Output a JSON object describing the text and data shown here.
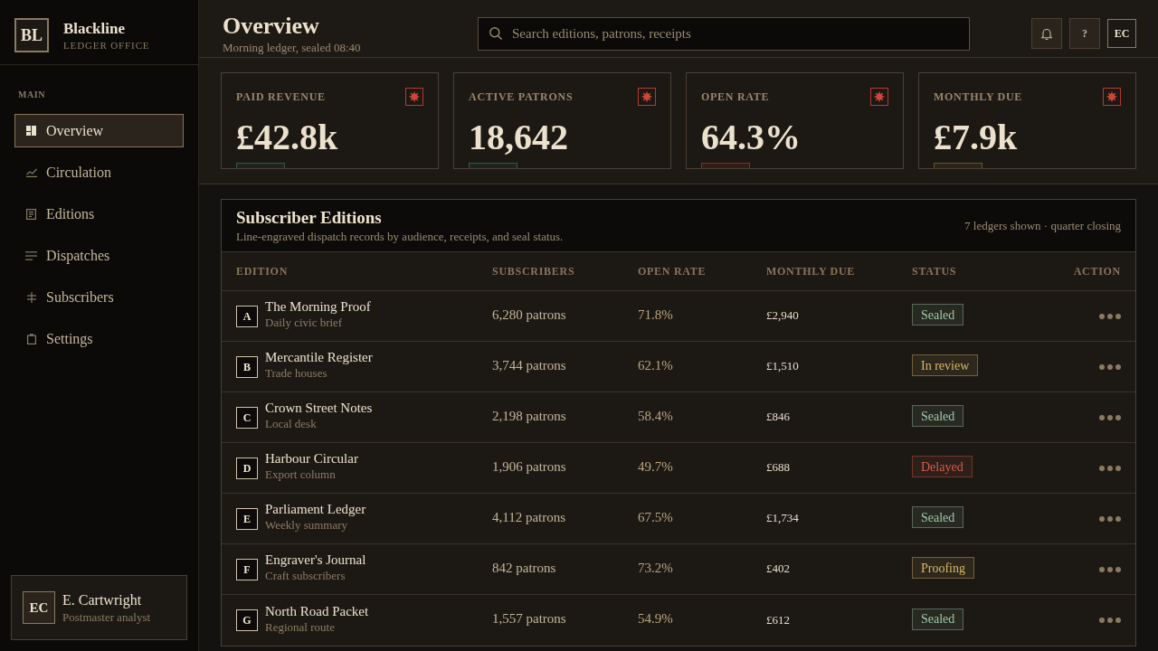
{
  "sidebar": {
    "brand": {
      "logo": "BL",
      "name": "Blackline",
      "subtitle": "LEDGER OFFICE"
    },
    "section_label": "MAIN",
    "items": [
      {
        "label": "Overview",
        "selected": true
      },
      {
        "label": "Circulation",
        "selected": false
      },
      {
        "label": "Editions",
        "selected": false
      },
      {
        "label": "Dispatches",
        "selected": false
      },
      {
        "label": "Subscribers",
        "selected": false
      },
      {
        "label": "Settings",
        "selected": false
      }
    ],
    "user": {
      "initials": "EC",
      "name": "E. Cartwright",
      "role": "Postmaster analyst"
    }
  },
  "header": {
    "title": "Overview",
    "subtitle": "Morning ledger, sealed 08:40",
    "search": {
      "placeholder": "Search editions, patrons, receipts"
    },
    "help_label": "?",
    "avatar": "EC"
  },
  "stats": [
    {
      "label": "PAID REVENUE",
      "value": "£42.8k",
      "color": "#2f5a45"
    },
    {
      "label": "ACTIVE PATRONS",
      "value": "18,642",
      "color": "#2f5a45"
    },
    {
      "label": "OPEN RATE",
      "value": "64.3%",
      "color": "#8f2a22"
    },
    {
      "label": "MONTHLY DUE",
      "value": "£7.9k",
      "color": "#6b5424"
    }
  ],
  "table": {
    "title": "Subscriber Editions",
    "description": "Line-engraved dispatch records by audience, receipts, and seal status.",
    "meta": "7 ledgers shown · quarter closing",
    "columns": [
      "EDITION",
      "SUBSCRIBERS",
      "OPEN RATE",
      "MONTHLY DUE",
      "STATUS",
      "ACTION"
    ],
    "rows": [
      {
        "initial": "A",
        "name": "The Morning Proof",
        "subtitle": "Daily civic brief",
        "subscribers": "6,280 patrons",
        "open_rate": "71.8%",
        "monthly_due": "£2,940",
        "status": {
          "label": "Sealed",
          "color": "#9fcba8"
        }
      },
      {
        "initial": "B",
        "name": "Mercantile Register",
        "subtitle": "Trade houses",
        "subscribers": "3,744 patrons",
        "open_rate": "62.1%",
        "monthly_due": "£1,510",
        "status": {
          "label": "In review",
          "color": "#d9b868"
        }
      },
      {
        "initial": "C",
        "name": "Crown Street Notes",
        "subtitle": "Local desk",
        "subscribers": "2,198 patrons",
        "open_rate": "58.4%",
        "monthly_due": "£846",
        "status": {
          "label": "Sealed",
          "color": "#9fcba8"
        }
      },
      {
        "initial": "D",
        "name": "Harbour Circular",
        "subtitle": "Export column",
        "subscribers": "1,906 patrons",
        "open_rate": "49.7%",
        "monthly_due": "£688",
        "status": {
          "label": "Delayed",
          "color": "#d95a4b"
        }
      },
      {
        "initial": "E",
        "name": "Parliament Ledger",
        "subtitle": "Weekly summary",
        "subscribers": "4,112 patrons",
        "open_rate": "67.5%",
        "monthly_due": "£1,734",
        "status": {
          "label": "Sealed",
          "color": "#9fcba8"
        }
      },
      {
        "initial": "F",
        "name": "Engraver's Journal",
        "subtitle": "Craft subscribers",
        "subscribers": "842 patrons",
        "open_rate": "73.2%",
        "monthly_due": "£402",
        "status": {
          "label": "Proofing",
          "color": "#d9b868"
        }
      },
      {
        "initial": "G",
        "name": "North Road Packet",
        "subtitle": "Regional route",
        "subscribers": "1,557 patrons",
        "open_rate": "54.9%",
        "monthly_due": "£612",
        "status": {
          "label": "Sealed",
          "color": "#9fcba8"
        }
      }
    ]
  }
}
